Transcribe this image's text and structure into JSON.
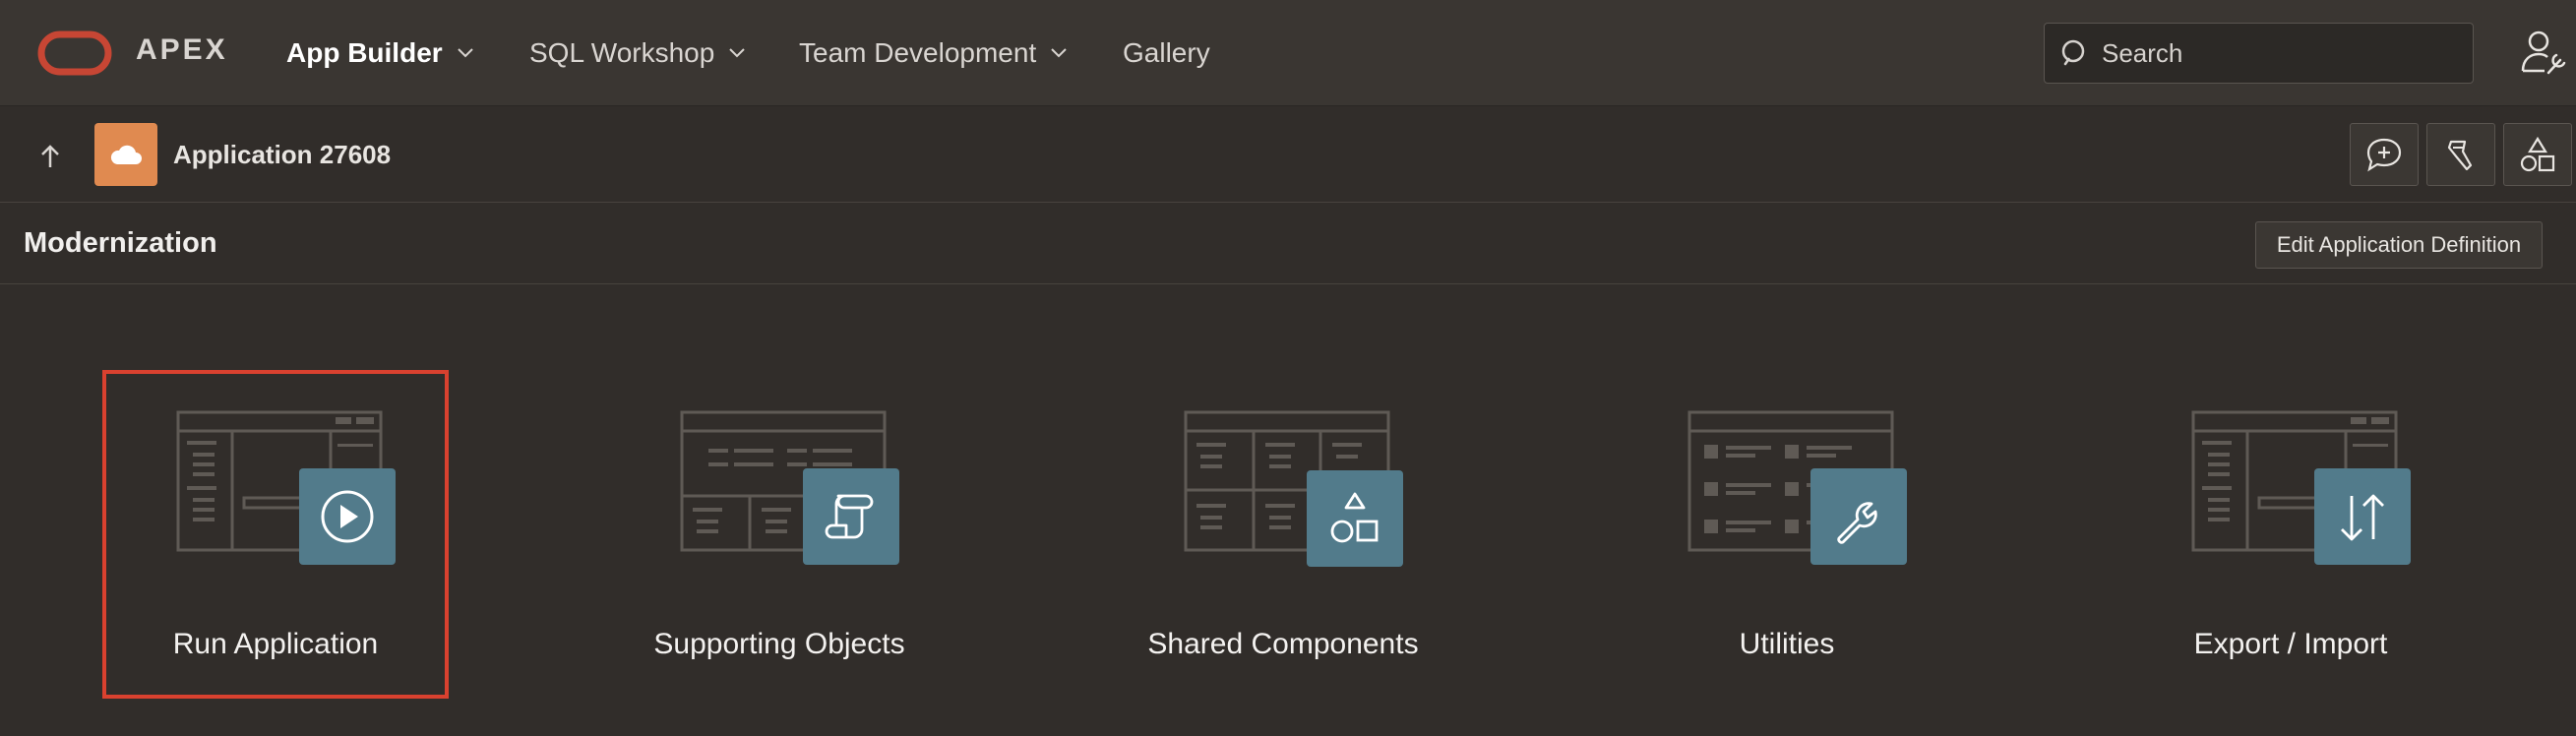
{
  "header": {
    "brand": "APEX",
    "nav": [
      {
        "label": "App Builder",
        "active": true,
        "has_menu": true
      },
      {
        "label": "SQL Workshop",
        "active": false,
        "has_menu": true
      },
      {
        "label": "Team Development",
        "active": false,
        "has_menu": true
      },
      {
        "label": "Gallery",
        "active": false,
        "has_menu": false
      }
    ],
    "search": {
      "placeholder": "Search",
      "value": ""
    }
  },
  "appbar": {
    "app_name": "Application 27608",
    "app_icon": "cloud-icon",
    "tools": [
      "feedback-icon",
      "highlighter-icon",
      "shapes-icon"
    ]
  },
  "region": {
    "title": "Modernization",
    "edit_button": "Edit Application Definition"
  },
  "cards": [
    {
      "label": "Run Application",
      "icon": "play-icon",
      "selected": true
    },
    {
      "label": "Supporting Objects",
      "icon": "scroll-icon",
      "selected": false
    },
    {
      "label": "Shared Components",
      "icon": "shapes-icon",
      "selected": false
    },
    {
      "label": "Utilities",
      "icon": "wrench-icon",
      "selected": false
    },
    {
      "label": "Export / Import",
      "icon": "arrows-up-down-icon",
      "selected": false
    }
  ],
  "colors": {
    "header_bg": "#3a3632",
    "page_bg": "#312d2a",
    "accent_orange": "#e08a50",
    "oracle_red": "#c74634",
    "selection_outline": "#d9412f",
    "card_badge": "#527b8b"
  }
}
